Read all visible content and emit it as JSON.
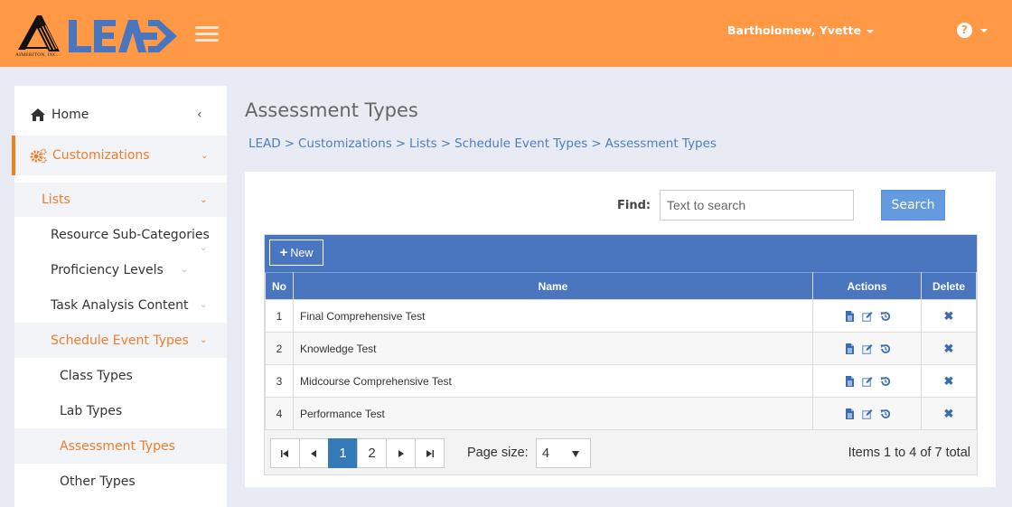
{
  "header": {
    "logo_caption": "AIMERITON, INC.",
    "logo_text": "LEAD",
    "user_name": "Bartholomew, Yvette",
    "help_icon": "question-circle-icon",
    "colors": {
      "bar": "#ff9946",
      "logo_blue": "#4a76bf"
    }
  },
  "sidebar": {
    "home": {
      "label": "Home",
      "icon": "home-icon"
    },
    "customizations": {
      "label": "Customizations",
      "icon": "gears-icon"
    },
    "lists": {
      "label": "Lists"
    },
    "list_items": [
      {
        "label": "Resource Sub-Categories"
      },
      {
        "label": "Proficiency Levels"
      },
      {
        "label": "Task Analysis Content"
      },
      {
        "label": "Schedule Event Types"
      }
    ],
    "event_types": [
      {
        "label": "Class Types"
      },
      {
        "label": "Lab Types"
      },
      {
        "label": "Assessment Types"
      },
      {
        "label": "Other Types"
      }
    ],
    "active_color": "#ee7d2b"
  },
  "main": {
    "title": "Assessment Types",
    "breadcrumb": [
      "LEAD",
      "Customizations",
      "Lists",
      "Schedule Event Types",
      "Assessment Types"
    ],
    "breadcrumb_sep": ">",
    "find_label": "Find:",
    "search_placeholder": "Text to search",
    "search_button": "Search",
    "new_button": "New",
    "columns": {
      "no": "No",
      "name": "Name",
      "actions": "Actions",
      "delete": "Delete"
    },
    "rows": [
      {
        "no": "1",
        "name": "Final Comprehensive Test"
      },
      {
        "no": "2",
        "name": "Knowledge Test"
      },
      {
        "no": "3",
        "name": "Midcourse Comprehensive Test"
      },
      {
        "no": "4",
        "name": "Performance Test"
      }
    ],
    "row_action_icons": [
      "view-document-icon",
      "edit-icon",
      "history-icon"
    ],
    "delete_glyph": "✖",
    "pager": {
      "pages": [
        "1",
        "2"
      ],
      "current_page": "1",
      "page_size_label": "Page size:",
      "page_size": "4",
      "items_info": "Items 1 to 4 of 7 total"
    }
  }
}
